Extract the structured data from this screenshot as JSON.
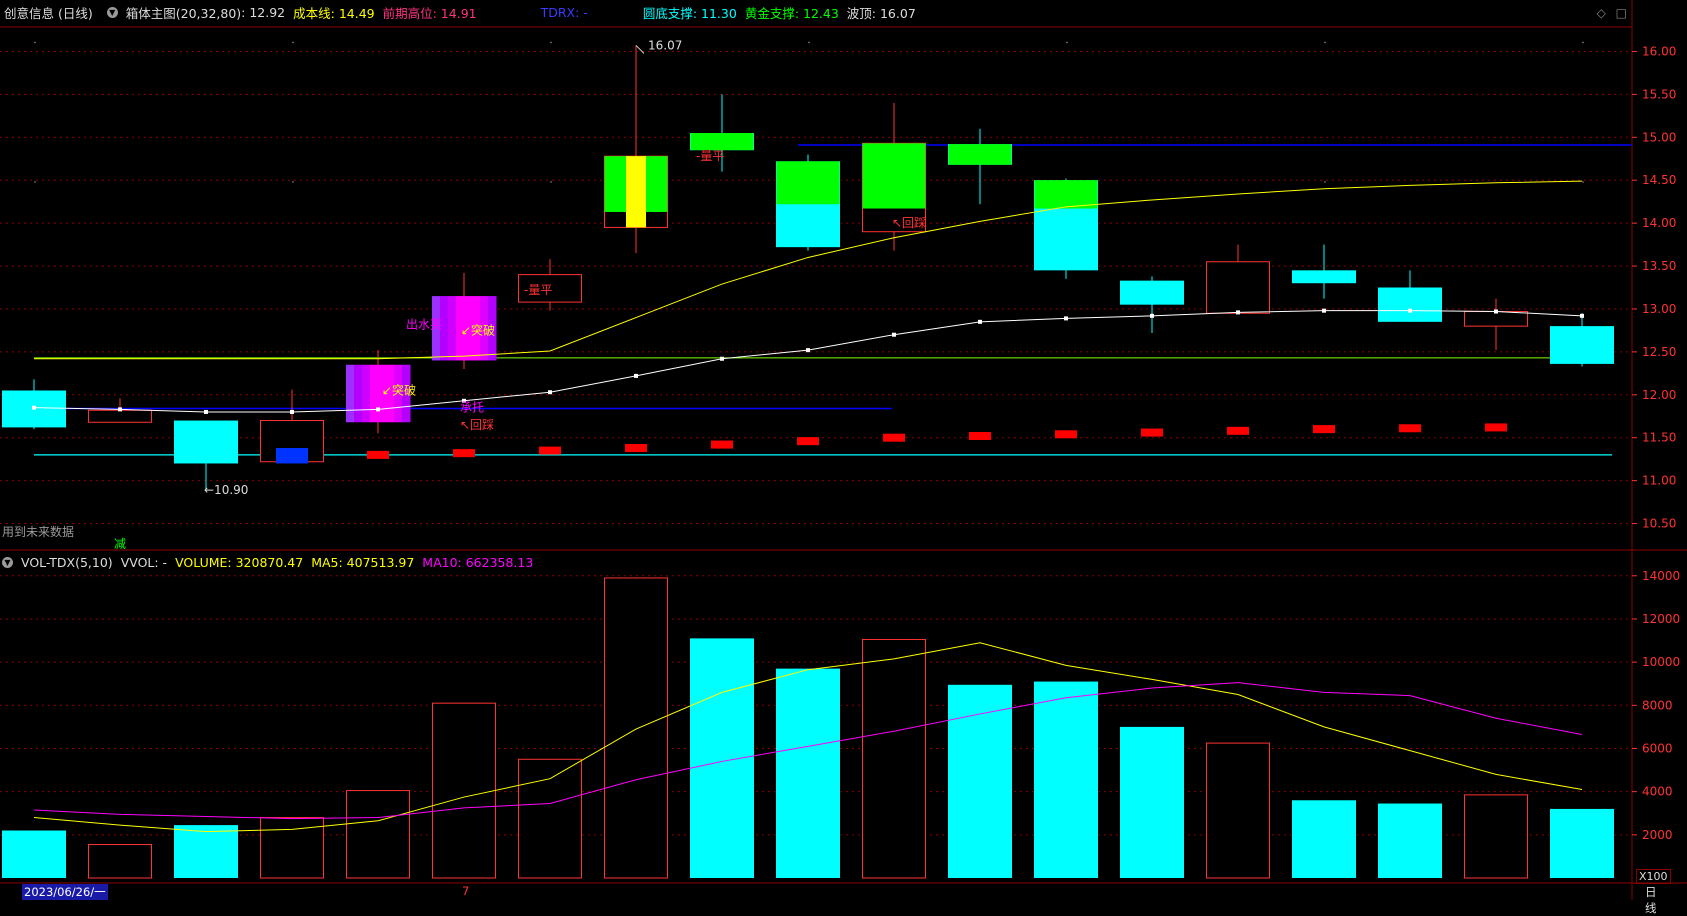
{
  "header": {
    "stock_name": "创意信息 (日线)",
    "indicator": "箱体主图(20,32,80)",
    "indicator_value": ": 12.92",
    "cost_line": "成本线: 14.49",
    "prev_high": "前期高位: 14.91",
    "tdrx": "TDRX: -",
    "circle_support": "圆底支撑: 11.30",
    "gold_support": "黄金支撑: 12.43",
    "wave_top": "波顶: 16.07"
  },
  "vol_header": {
    "name": "VOL-TDX(5,10)",
    "vvol": "VVOL: -",
    "volume": "VOLUME: 320870.47",
    "ma5": "MA5: 407513.97",
    "ma10": "MA10: 662358.13"
  },
  "footer": {
    "date": "2023/06/26/一",
    "marker": "7",
    "period": "日线",
    "future_data": "用到未来数据",
    "short_tag": "减",
    "vol_unit": "X100"
  },
  "colors": {
    "up": "#ff3333",
    "down": "#00ffff",
    "ma_white": "#ffffff",
    "ma_yellow": "#ffff00",
    "ma10": "#ff00ff",
    "grid": "#8b0000",
    "support_green": "#7fff00",
    "support_cyan": "#00ffff",
    "prev_high_blue": "#0000ff"
  },
  "chart_data": [
    {
      "type": "candlestick",
      "title": "箱体主图(20,32,80)",
      "ylim": [
        10.25,
        16.25
      ],
      "y_ticks": [
        "10.50",
        "11.00",
        "11.50",
        "12.00",
        "12.50",
        "13.00",
        "13.50",
        "14.00",
        "14.50",
        "15.00",
        "15.50",
        "16.00"
      ],
      "candles": [
        {
          "o": 12.05,
          "h": 12.18,
          "l": 11.6,
          "c": 11.62
        },
        {
          "o": 11.68,
          "h": 11.96,
          "l": 11.68,
          "c": 11.82
        },
        {
          "o": 11.7,
          "h": 11.7,
          "l": 10.9,
          "c": 11.2
        },
        {
          "o": 11.22,
          "h": 12.06,
          "l": 11.2,
          "c": 11.7
        },
        {
          "o": 11.68,
          "h": 12.52,
          "l": 11.55,
          "c": 12.35
        },
        {
          "o": 12.4,
          "h": 13.42,
          "l": 12.3,
          "c": 13.15
        },
        {
          "o": 13.08,
          "h": 13.58,
          "l": 12.98,
          "c": 13.4
        },
        {
          "o": 13.95,
          "h": 16.07,
          "l": 13.65,
          "c": 14.78
        },
        {
          "o": 15.05,
          "h": 15.5,
          "l": 14.6,
          "c": 14.85
        },
        {
          "o": 14.72,
          "h": 14.8,
          "l": 13.68,
          "c": 13.72
        },
        {
          "o": 13.9,
          "h": 15.4,
          "l": 13.68,
          "c": 14.93
        },
        {
          "o": 14.92,
          "h": 15.1,
          "l": 14.22,
          "c": 14.68
        },
        {
          "o": 14.5,
          "h": 14.52,
          "l": 13.35,
          "c": 13.45
        },
        {
          "o": 13.33,
          "h": 13.38,
          "l": 12.72,
          "c": 13.05
        },
        {
          "o": 12.95,
          "h": 13.75,
          "l": 12.95,
          "c": 13.55
        },
        {
          "o": 13.45,
          "h": 13.75,
          "l": 13.12,
          "c": 13.3
        },
        {
          "o": 13.25,
          "h": 13.45,
          "l": 12.85,
          "c": 12.85
        },
        {
          "o": 12.8,
          "h": 13.12,
          "l": 12.52,
          "c": 12.97
        },
        {
          "o": 12.8,
          "h": 12.95,
          "l": 12.33,
          "c": 12.36
        }
      ],
      "ma_white": [
        11.85,
        11.83,
        11.8,
        11.8,
        11.83,
        11.93,
        12.03,
        12.22,
        12.42,
        12.52,
        12.7,
        12.85,
        12.89,
        12.92,
        12.96,
        12.98,
        12.98,
        12.97,
        12.92
      ],
      "ma_yellow": [
        12.42,
        12.42,
        12.42,
        12.42,
        12.42,
        12.45,
        12.51,
        12.9,
        13.29,
        13.6,
        13.83,
        14.02,
        14.19,
        14.27,
        14.34,
        14.4,
        14.44,
        14.47,
        14.49
      ],
      "red_markers": [
        11.3,
        11.32,
        11.35,
        11.38,
        11.42,
        11.46,
        11.5,
        11.52,
        11.54,
        11.56,
        11.58,
        11.6,
        11.61,
        11.62
      ],
      "lines": {
        "prev_high": 14.91,
        "ma_blue": 11.84,
        "gold_support": 12.43,
        "circle_support": 11.3
      },
      "annotations": {
        "low": "←10.90",
        "high": "16.07",
        "breakout1": "突破",
        "breakout2": "突破",
        "ping1": "量平",
        "ping2": "量平",
        "pullback1": "回踩",
        "pullback2": "回踩",
        "support_up": "承托",
        "out_water": "出水芙"
      }
    },
    {
      "type": "bar",
      "title": "VOL-TDX(5,10)",
      "ylim": [
        0,
        14500
      ],
      "y_ticks": [
        "2000",
        "4000",
        "6000",
        "8000",
        "10000",
        "12000",
        "14000"
      ],
      "volumes": [
        2200,
        1550,
        2450,
        2800,
        4050,
        8100,
        5500,
        13900,
        11100,
        9700,
        11050,
        8950,
        9100,
        7000,
        6250,
        3600,
        3450,
        3850,
        3200
      ],
      "ma5": [
        2800,
        2450,
        2150,
        2250,
        2650,
        3750,
        4600,
        6900,
        8600,
        9650,
        10150,
        10900,
        9850,
        9200,
        8500,
        7000,
        5900,
        4800,
        4100
      ],
      "ma10": [
        3150,
        2950,
        2850,
        2750,
        2800,
        3250,
        3450,
        4550,
        5400,
        6100,
        6800,
        7600,
        8350,
        8800,
        9050,
        8600,
        8450,
        7400,
        6650
      ]
    }
  ]
}
